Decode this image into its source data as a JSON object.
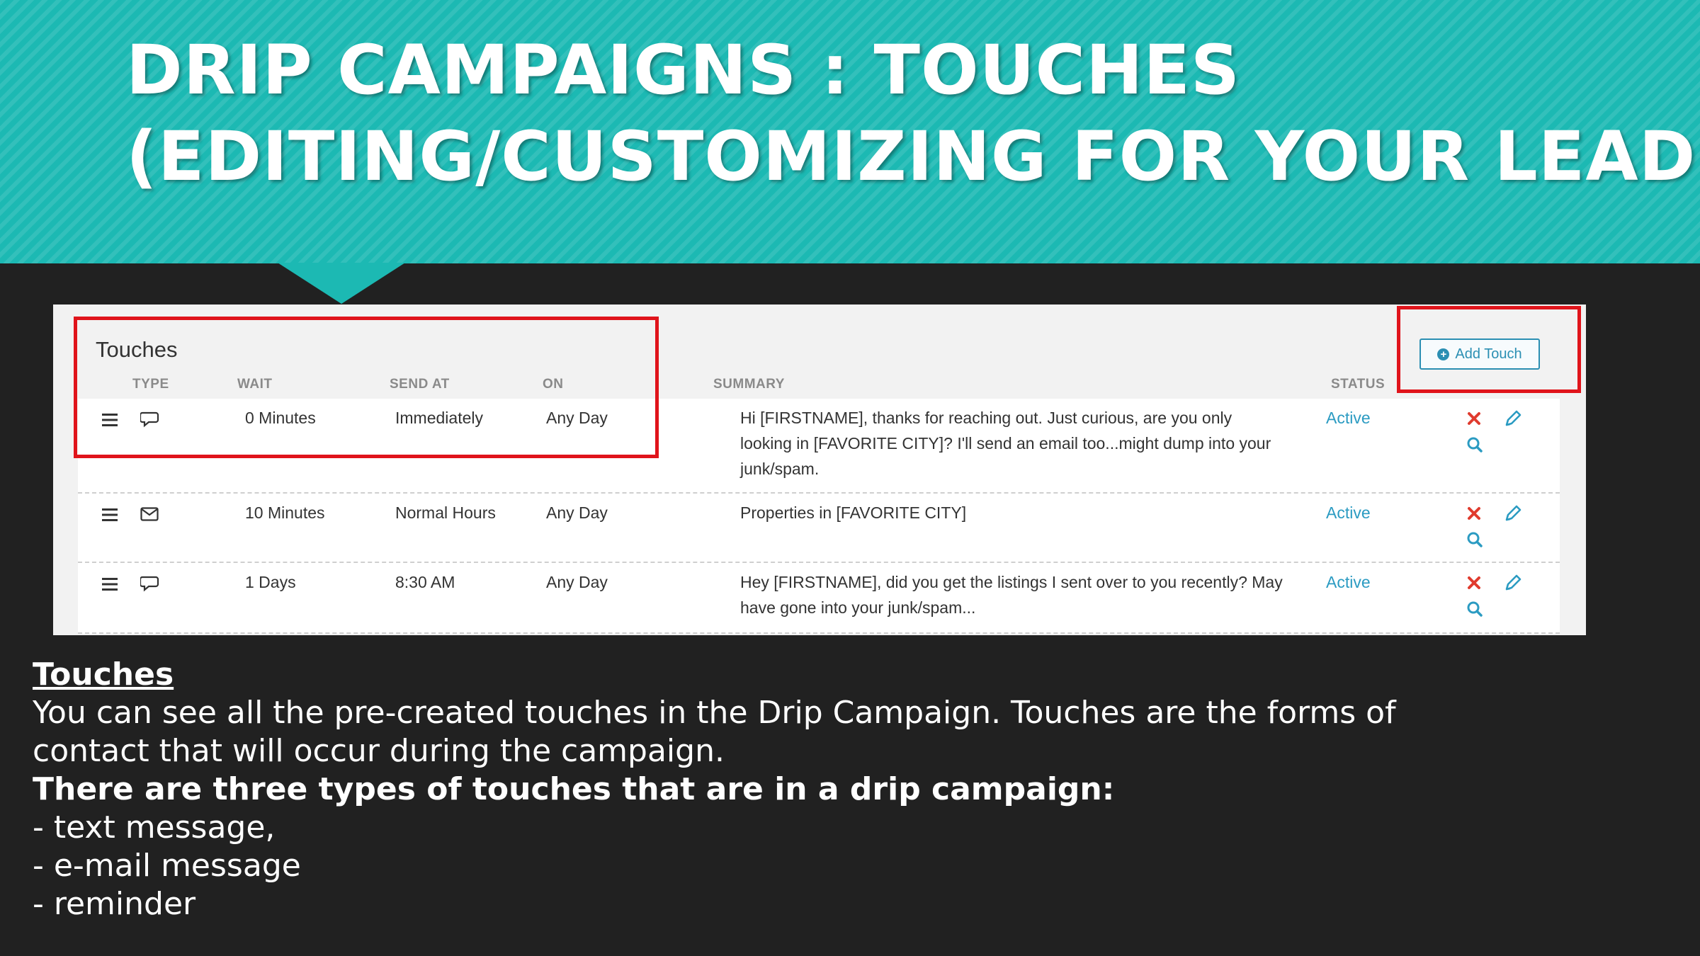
{
  "slide": {
    "title_line1": "DRIP CAMPAIGNS : TOUCHES",
    "title_line2": "(EDITING/CUSTOMIZING FOR YOUR LEADS)"
  },
  "colors": {
    "banner": "#1cb9b3",
    "background": "#212121",
    "highlight_box": "#e0141b",
    "link": "#2b9bc2",
    "delete": "#e03b2e"
  },
  "panel": {
    "title": "Touches",
    "add_button": "Add Touch",
    "columns": {
      "type": "TYPE",
      "wait": "WAIT",
      "send_at": "SEND AT",
      "on": "ON",
      "summary": "SUMMARY",
      "status": "STATUS"
    },
    "rows": [
      {
        "type_icon": "chat-icon",
        "wait": "0 Minutes",
        "send_at": "Immediately",
        "on": "Any Day",
        "summary_line1": "Hi [FIRSTNAME], thanks for reaching out. Just curious, are you only",
        "summary_line2": "looking in [FAVORITE CITY]? I'll send an email too...might dump into your",
        "summary_line3": "junk/spam.",
        "status": "Active"
      },
      {
        "type_icon": "envelope-icon",
        "wait": "10 Minutes",
        "send_at": "Normal Hours",
        "on": "Any Day",
        "summary_line1": "Properties in [FAVORITE CITY]",
        "status": "Active"
      },
      {
        "type_icon": "chat-icon",
        "wait": "1 Days",
        "send_at": "8:30 AM",
        "on": "Any Day",
        "summary_line1": "Hey [FIRSTNAME], did you get the listings I sent over to you recently? May",
        "summary_line2": "have gone into your junk/spam...",
        "status": "Active"
      }
    ]
  },
  "description": {
    "heading": "Touches",
    "line1": "You can see all the pre-created touches in the Drip Campaign. Touches are the forms of",
    "line2": "contact that will occur during the campaign.",
    "line3": "There are three types of touches that are in a drip campaign:",
    "item1": "- text message,",
    "item2": "- e-mail message",
    "item3": "- reminder"
  }
}
